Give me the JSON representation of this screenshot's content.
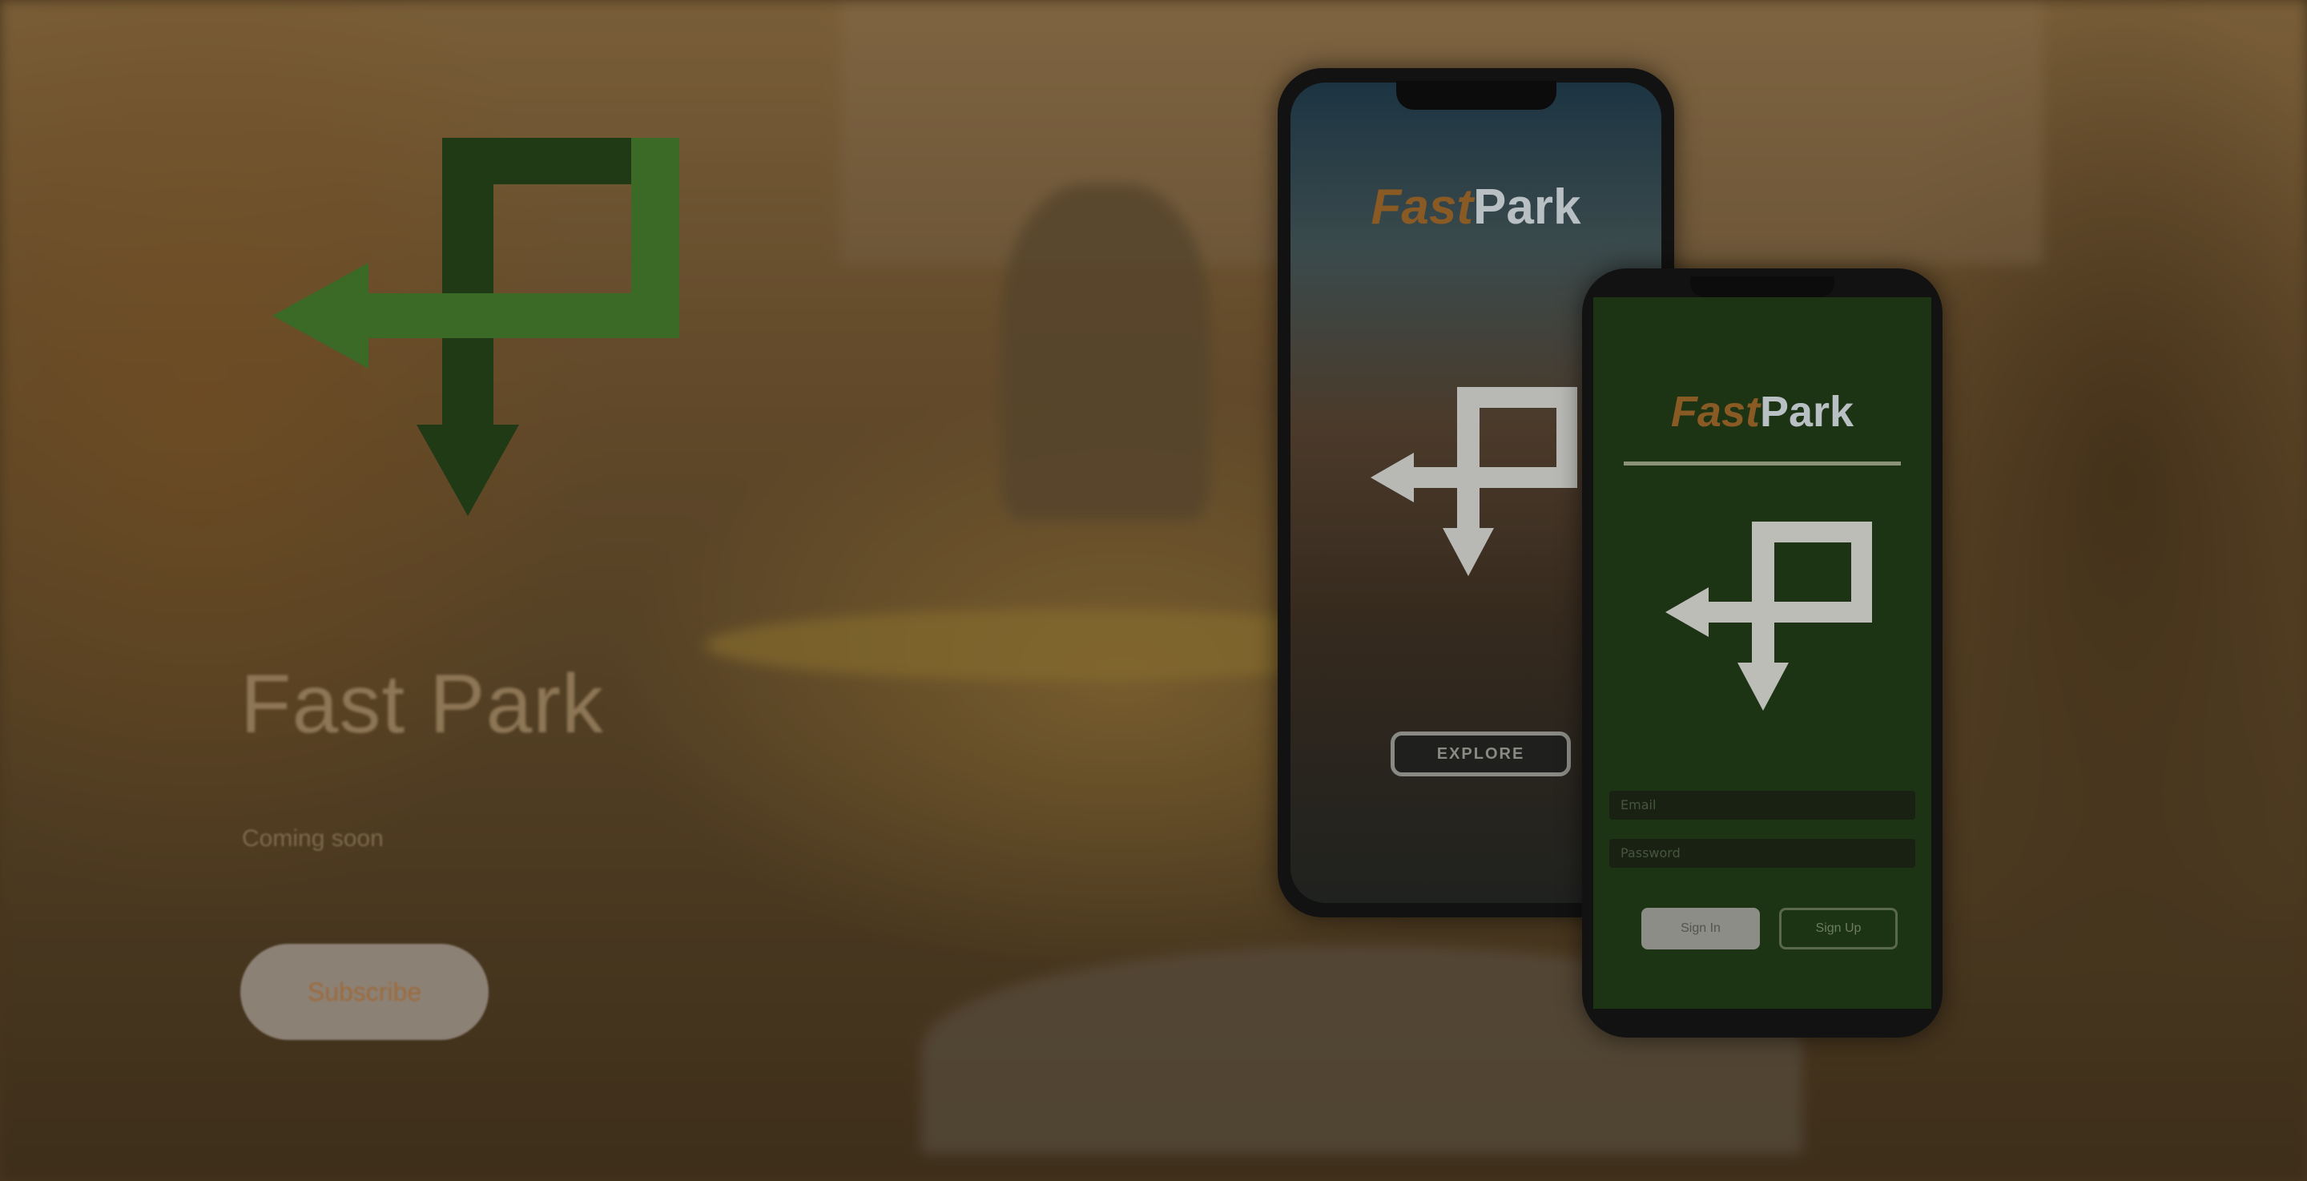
{
  "hero": {
    "title": "Fast Park",
    "subtitle": "Coming soon",
    "subscribe_label": "Subscribe"
  },
  "phone_back": {
    "app_title_fast": "Fast",
    "app_title_park": "Park",
    "button_label": "EXPLORE"
  },
  "phone_front": {
    "app_title_fast": "Fast",
    "app_title_park": "Park",
    "field_1_placeholder": "Email",
    "field_2_placeholder": "Password",
    "signin_label": "Sign In",
    "signup_label": "Sign Up"
  },
  "colors": {
    "logo_dark_green": "#1f3a15",
    "logo_light_green": "#3d6e27",
    "app_green": "#1c3414",
    "accent_orange": "#8a5a25"
  },
  "icons": [
    "fast-park-logo-icon"
  ]
}
